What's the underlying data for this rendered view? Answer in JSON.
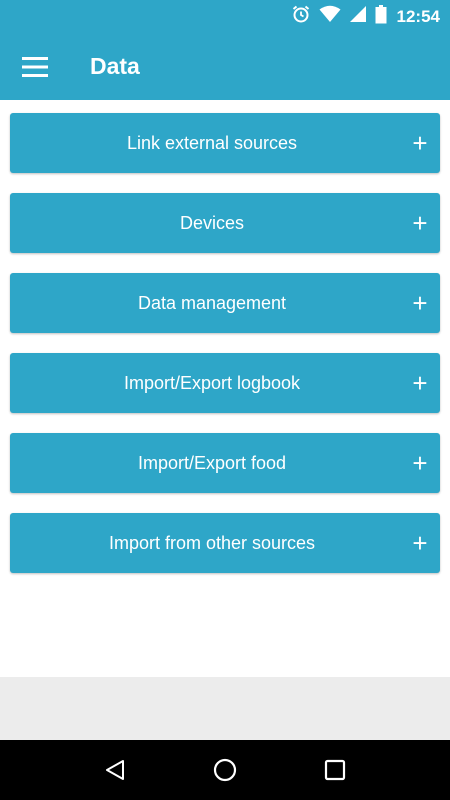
{
  "status_bar": {
    "time": "12:54",
    "icons": [
      "alarm-icon",
      "wifi-icon",
      "signal-icon",
      "battery-icon"
    ]
  },
  "app_bar": {
    "title": "Data",
    "menu_icon": "hamburger-menu-icon"
  },
  "items": [
    {
      "label": "Link external sources",
      "icon": "plus-icon"
    },
    {
      "label": "Devices",
      "icon": "plus-icon"
    },
    {
      "label": "Data management",
      "icon": "plus-icon"
    },
    {
      "label": "Import/Export logbook",
      "icon": "plus-icon"
    },
    {
      "label": "Import/Export food",
      "icon": "plus-icon"
    },
    {
      "label": "Import from other sources",
      "icon": "plus-icon"
    }
  ],
  "nav_bar": {
    "icons": [
      "back-icon",
      "home-icon",
      "recents-icon"
    ]
  },
  "colors": {
    "primary": "#2ea6c8",
    "nav_background": "#000000",
    "footer_grey": "#ececec"
  }
}
